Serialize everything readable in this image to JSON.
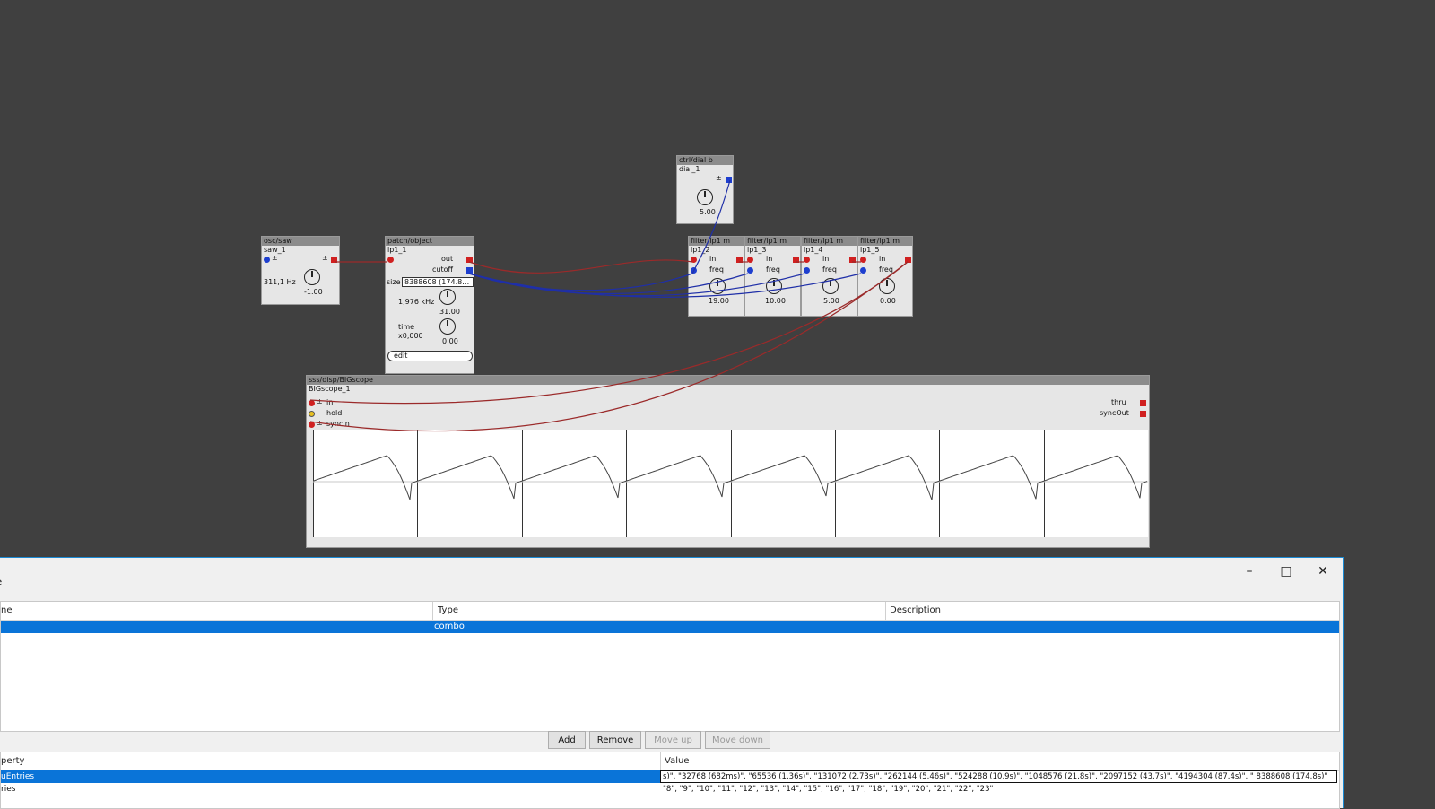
{
  "objects": {
    "saw": {
      "type": "osc/saw",
      "name": "saw_1",
      "freq": "311,1 Hz",
      "knob": "-1.00"
    },
    "lp1": {
      "type": "patch/object",
      "name": "lp1_1",
      "out": "out",
      "cutoff": "cutoff",
      "size_label": "size",
      "size_value": "8388608 (174.8…",
      "hz": "1,976 kHz",
      "knob1": "31.00",
      "time_label": "time",
      "time_value": "x0,000",
      "knob2": "0.00",
      "edit": "edit"
    },
    "dial": {
      "type": "ctrl/dial b",
      "name": "dial_1",
      "value": "5.00"
    },
    "filters": [
      {
        "type": "filter/lp1 m",
        "name": "lp1_2",
        "in": "in",
        "freq": "freq",
        "value": "19.00"
      },
      {
        "type": "filter/lp1 m",
        "name": "lp1_3",
        "in": "in",
        "freq": "freq",
        "value": "10.00"
      },
      {
        "type": "filter/lp1 m",
        "name": "lp1_4",
        "in": "in",
        "freq": "freq",
        "value": "5.00"
      },
      {
        "type": "filter/lp1 m",
        "name": "lp1_5",
        "in": "in",
        "freq": "freq",
        "value": "0.00"
      }
    ],
    "scope": {
      "type": "sss/disp/BIGscope",
      "name": "BIGscope_1",
      "in": "in",
      "hold": "hold",
      "syncin": "syncIn",
      "thru": "thru",
      "syncout": "syncOut"
    }
  },
  "dialog": {
    "minimize": "–",
    "maximize": "□",
    "close": "✕",
    "top_marker": "e",
    "table_headers": {
      "name": "ne",
      "type": "Type",
      "description": "Description"
    },
    "table_rows": [
      {
        "name": "",
        "type": "combo",
        "description": ""
      }
    ],
    "buttons": {
      "add": "Add",
      "remove": "Remove",
      "move_up": "Move up",
      "move_down": "Move down"
    },
    "props_headers": {
      "property": "perty",
      "value": "Value"
    },
    "props_rows": [
      {
        "property": "uEntries",
        "value": "s)\", \"32768 (682ms)\", \"65536 (1.36s)\", \"131072 (2.73s)\", \"262144 (5.46s)\", \"524288 (10.9s)\", \"1048576 (21.8s)\", \"2097152 (43.7s)\", \"4194304 (87.4s)\", \" 8388608 (174.8s)\""
      },
      {
        "property": "ries",
        "value": "\"8\", \"9\", \"10\", \"11\", \"12\", \"13\", \"14\", \"15\", \"16\", \"17\", \"18\", \"19\", \"20\", \"21\", \"22\", \"23\""
      }
    ]
  },
  "colors": {
    "canvas": "#404040",
    "wire_red": "#9b2a2a",
    "wire_blue": "#1f2fa8",
    "selection": "#0a74d8"
  }
}
